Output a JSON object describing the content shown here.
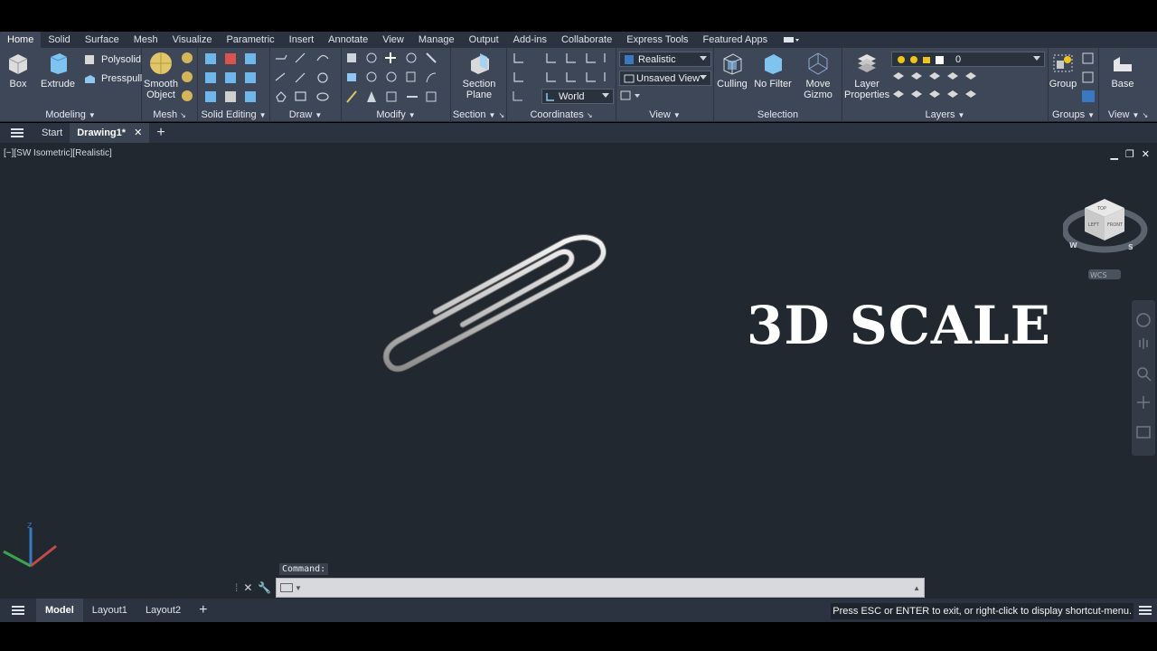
{
  "ribbon_tabs": [
    "Home",
    "Solid",
    "Surface",
    "Mesh",
    "Visualize",
    "Parametric",
    "Insert",
    "Annotate",
    "View",
    "Manage",
    "Output",
    "Add-ins",
    "Collaborate",
    "Express Tools",
    "Featured Apps"
  ],
  "panels": {
    "modeling": {
      "title": "Modeling",
      "box": "Box",
      "extrude": "Extrude",
      "polysolid": "Polysolid",
      "presspull": "Presspull"
    },
    "mesh": {
      "title": "Mesh",
      "smooth_object_l1": "Smooth",
      "smooth_object_l2": "Object"
    },
    "solid_editing": {
      "title": "Solid Editing"
    },
    "draw": {
      "title": "Draw"
    },
    "modify": {
      "title": "Modify"
    },
    "section": {
      "title": "Section",
      "section_plane_l1": "Section",
      "section_plane_l2": "Plane"
    },
    "coordinates": {
      "title": "Coordinates",
      "ucs": "World"
    },
    "view": {
      "title": "View",
      "visual_style": "Realistic",
      "named_view": "Unsaved View"
    },
    "selection": {
      "title": "Selection",
      "culling": "Culling",
      "no_filter": "No Filter",
      "move_gizmo_l1": "Move",
      "move_gizmo_l2": "Gizmo"
    },
    "layers": {
      "title": "Layers",
      "layer_properties_l1": "Layer",
      "layer_properties_l2": "Properties",
      "current_layer": "0"
    },
    "groups": {
      "title": "Groups",
      "group": "Group"
    },
    "view2": {
      "title": "View",
      "base": "Base"
    }
  },
  "file_tabs": {
    "start": "Start",
    "drawing": "Drawing1*"
  },
  "viewport": {
    "label": "[−][SW Isometric][Realistic]",
    "overlay_title": "3D SCALE",
    "viewcube": {
      "top": "TOP",
      "left": "LEFT",
      "front": "FRONT",
      "wcs": "WCS",
      "west": "W",
      "south": "S"
    }
  },
  "command": {
    "label": "Command:"
  },
  "layout_tabs": [
    "Model",
    "Layout1",
    "Layout2"
  ],
  "status_message": "Press ESC or ENTER to exit, or right-click to display shortcut-menu.",
  "colors": {
    "ribbon": "#3d4757",
    "viewport": "#212830",
    "accent": "#4a90d9"
  }
}
